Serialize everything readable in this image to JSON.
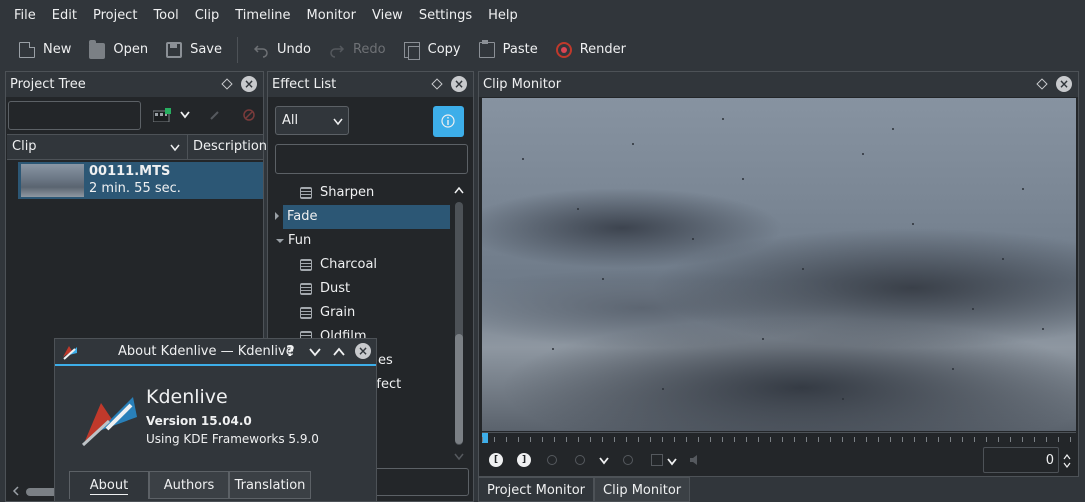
{
  "menu": [
    "File",
    "Edit",
    "Project",
    "Tool",
    "Clip",
    "Timeline",
    "Monitor",
    "View",
    "Settings",
    "Help"
  ],
  "toolbar": {
    "new": "New",
    "open": "Open",
    "save": "Save",
    "undo": "Undo",
    "redo": "Redo",
    "copy": "Copy",
    "paste": "Paste",
    "render": "Render"
  },
  "project_tree": {
    "title": "Project Tree",
    "search_value": "",
    "col_clip": "Clip",
    "col_description": "Description",
    "clip": {
      "name": "00111.MTS",
      "duration": "2 min. 55 sec."
    }
  },
  "effect_list": {
    "title": "Effect List",
    "filter_selected": "All",
    "search_value": "",
    "items": {
      "sharpen": "Sharpen",
      "fade": "Fade",
      "fun": "Fun",
      "charcoal": "Charcoal",
      "dust": "Dust",
      "grain": "Grain",
      "oldfilm": "Oldfilm",
      "partial_1": "es",
      "partial_2": "ffect"
    }
  },
  "clip_monitor": {
    "title": "Clip Monitor",
    "timecode": "0",
    "tabs": {
      "project": "Project Monitor",
      "clip": "Clip Monitor"
    }
  },
  "about": {
    "window_title": "About Kdenlive — Kdenlive",
    "help_glyph": "?",
    "app_name": "Kdenlive",
    "version": "Version 15.04.0",
    "frameworks": "Using KDE Frameworks 5.9.0",
    "tabs": {
      "about": "About",
      "authors": "Authors",
      "translation": "Translation"
    }
  },
  "colors": {
    "accent": "#3daee9",
    "bg": "#31363b",
    "panel": "#232629",
    "selection": "#2c5775"
  }
}
